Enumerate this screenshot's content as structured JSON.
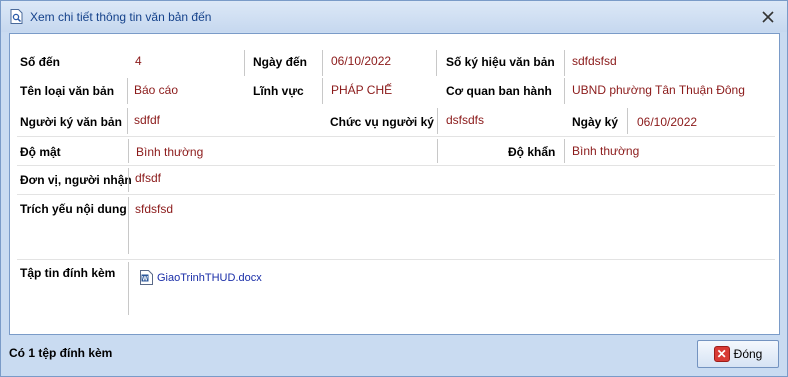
{
  "window": {
    "title": "Xem chi tiết thông tin văn bản đến"
  },
  "fields": {
    "so_den_label": "Số đến",
    "so_den_value": "4",
    "ngay_den_label": "Ngày đến",
    "ngay_den_value": "06/10/2022",
    "so_ky_hieu_label": "Số ký hiệu văn bản",
    "so_ky_hieu_value": "sdfdsfsd",
    "ten_loai_label": "Tên loại văn bản",
    "ten_loai_value": "Báo cáo",
    "linh_vuc_label": "Lĩnh vực",
    "linh_vuc_value": "PHÁP CHẾ",
    "co_quan_label": "Cơ quan ban hành",
    "co_quan_value": "UBND phường Tân Thuận Đông",
    "nguoi_ky_label": "Người ký văn bản",
    "nguoi_ky_value": "sdfdf",
    "chuc_vu_label": "Chức vụ người ký",
    "chuc_vu_value": "dsfsdfs",
    "ngay_ky_label": "Ngày ký",
    "ngay_ky_value": "06/10/2022",
    "do_mat_label": "Độ mật",
    "do_mat_value": "Bình thường",
    "do_khan_label": "Độ khẩn",
    "do_khan_value": "Bình thường",
    "don_vi_label": "Đơn vị, người nhận",
    "don_vi_value": "dfsdf",
    "trich_yeu_label": "Trích yếu nội dung",
    "trich_yeu_value": "sfdsfsd",
    "tap_tin_label": "Tập tin đính kèm"
  },
  "attachments": [
    {
      "filename": "GiaoTrinhTHUD.docx",
      "icon": "word-doc-icon"
    }
  ],
  "status": {
    "text": "Có 1 tệp đính kèm"
  },
  "buttons": {
    "close_label": "Đóng"
  },
  "colors": {
    "value_text": "#8b1a1a",
    "link_text": "#1a2ea8",
    "title_text": "#15428b"
  }
}
